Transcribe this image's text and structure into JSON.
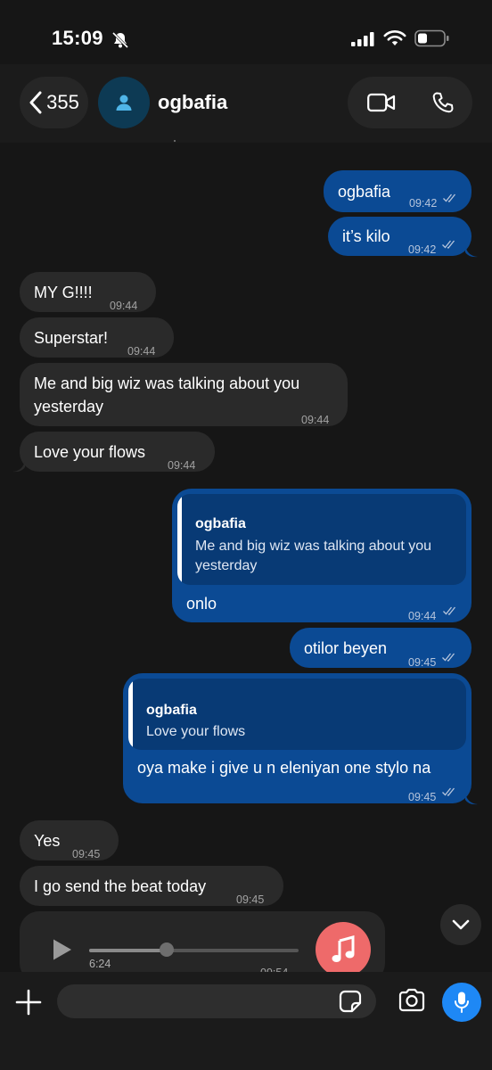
{
  "status_bar": {
    "time": "15:09"
  },
  "header": {
    "back_count": "355",
    "contact_name": "ogbafia"
  },
  "messages": [
    {
      "direction": "out",
      "text": "ogbafia",
      "time": "09:42"
    },
    {
      "direction": "out",
      "text": "it’s kilo",
      "time": "09:42"
    },
    {
      "direction": "in",
      "text": "MY G!!!!",
      "time": "09:44"
    },
    {
      "direction": "in",
      "text": "Superstar!",
      "time": "09:44"
    },
    {
      "direction": "in",
      "text_line1": "Me and big wiz was talking about you",
      "text_line2": "yesterday",
      "time": "09:44"
    },
    {
      "direction": "in",
      "text": "Love your flows",
      "time": "09:44"
    },
    {
      "direction": "out",
      "quote_name": "ogbafia",
      "quote_line1": "Me and big wiz was talking about you",
      "quote_line2": "yesterday",
      "text": "onlo",
      "time": "09:44"
    },
    {
      "direction": "out",
      "text": "otilor beyen",
      "time": "09:45"
    },
    {
      "direction": "out",
      "quote_name": "ogbafia",
      "quote_line1": "Love your flows",
      "text": "oya make i give u n eleniyan one stylo na",
      "time": "09:45"
    },
    {
      "direction": "in",
      "text": "Yes",
      "time": "09:45"
    },
    {
      "direction": "in",
      "text": "I go send the beat today",
      "time": "09:45"
    }
  ],
  "voice_note": {
    "duration": "6:24",
    "time": "09:54",
    "progress": 0.37
  },
  "composer": {
    "placeholder": ""
  },
  "icons": {
    "status": [
      "bell-slash-icon",
      "signal-icon",
      "wifi-icon",
      "battery-icon"
    ],
    "header": [
      "chevron-left-icon",
      "person-icon",
      "video-camera-icon",
      "phone-icon"
    ],
    "composer": [
      "plus-icon",
      "sticker-icon",
      "camera-icon",
      "microphone-icon"
    ],
    "other": [
      "play-icon",
      "music-note-icon",
      "chevron-down-icon",
      "double-check-icon"
    ]
  },
  "colors": {
    "background": "#161616",
    "outgoing_bubble": "#0b4a94",
    "incoming_bubble": "#2a2a2a",
    "quote_background": "#083a75",
    "accent_blue": "#1e88f5",
    "music_badge": "#ee6a6a",
    "avatar_bg": "#0d3a54"
  }
}
